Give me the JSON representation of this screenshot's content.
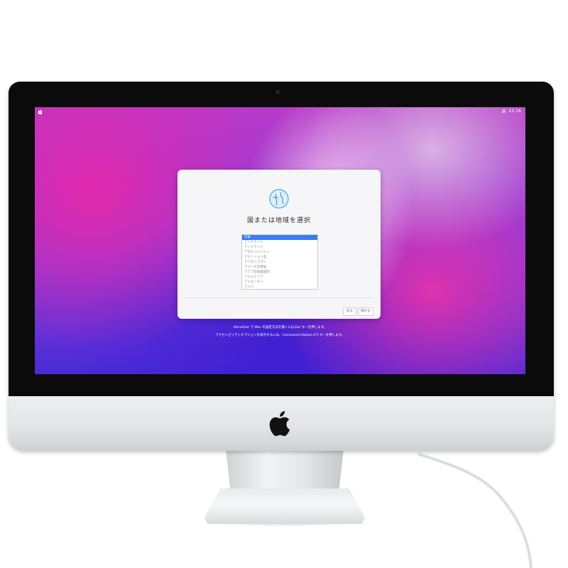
{
  "menubar": {
    "input_indicator": "あ",
    "clock": "21:16"
  },
  "dialog": {
    "title": "国または地域を選択",
    "regions": [
      {
        "label": "日本",
        "selected": true
      },
      {
        "label": "アイスランド",
        "selected": false
      },
      {
        "label": "アイルランド",
        "selected": false
      },
      {
        "label": "アゼルバイジャン",
        "selected": false
      },
      {
        "label": "アセンション島",
        "selected": false
      },
      {
        "label": "アフガニスタン",
        "selected": false
      },
      {
        "label": "アメリカ合衆国",
        "selected": false
      },
      {
        "label": "アラブ首長国連邦",
        "selected": false
      },
      {
        "label": "アルジェリア",
        "selected": false
      },
      {
        "label": "アルゼンチン",
        "selected": false
      },
      {
        "label": "アルバ",
        "selected": false
      }
    ],
    "back_label": "戻る",
    "continue_label": "続ける"
  },
  "hints": {
    "voiceover": "VoiceOver で Mac の設定方法を聞くには Esc キーを押します。",
    "accessibility": "アクセシビリティオプションを表示するには、Command+Option+F5 キーを押します。"
  },
  "colors": {
    "selection": "#3b7cf0",
    "wallpaper_magenta": "#e628aa",
    "wallpaper_blue": "#3c1ed2"
  }
}
